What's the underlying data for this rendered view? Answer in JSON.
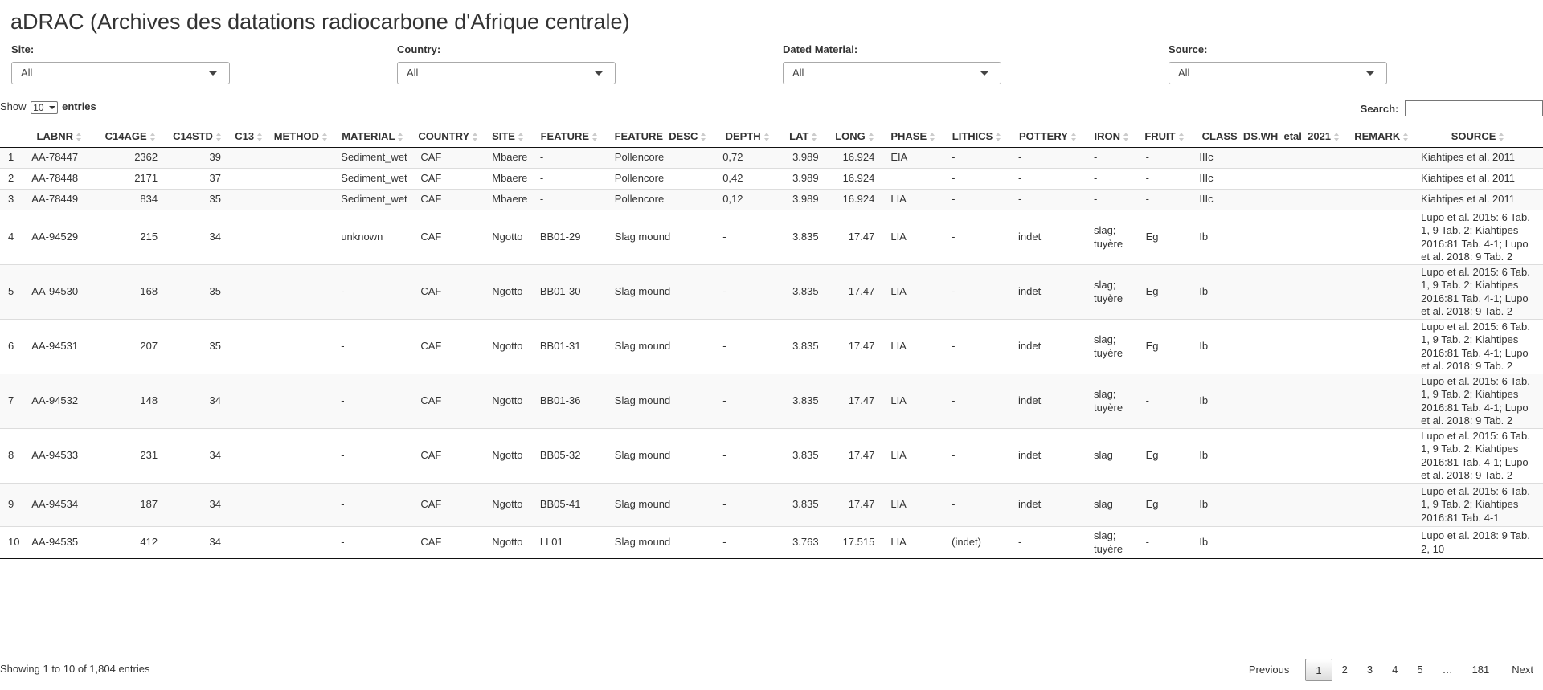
{
  "title": "aDRAC (Archives des datations radiocarbone d'Afrique centrale)",
  "filters": [
    {
      "label": "Site:",
      "value": "All"
    },
    {
      "label": "Country:",
      "value": "All"
    },
    {
      "label": "Dated Material:",
      "value": "All"
    },
    {
      "label": "Source:",
      "value": "All"
    }
  ],
  "length_control": {
    "prefix": "Show",
    "value": "10",
    "suffix": "entries"
  },
  "search": {
    "label": "Search:",
    "value": ""
  },
  "table": {
    "columns": [
      "",
      "LABNR",
      "C14AGE",
      "C14STD",
      "C13",
      "METHOD",
      "MATERIAL",
      "COUNTRY",
      "SITE",
      "FEATURE",
      "FEATURE_DESC",
      "DEPTH",
      "LAT",
      "LONG",
      "PHASE",
      "LITHICS",
      "POTTERY",
      "IRON",
      "FRUIT",
      "CLASS_DS.WH_etal_2021",
      "REMARK",
      "SOURCE"
    ],
    "rows": [
      [
        "1",
        "AA-78447",
        "2362",
        "39",
        "",
        "",
        "Sediment_wet",
        "CAF",
        "Mbaere",
        "-",
        "Pollencore",
        "0,72",
        "3.989",
        "16.924",
        "EIA",
        "-",
        "-",
        "-",
        "-",
        "IIIc",
        "",
        "Kiahtipes et al. 2011"
      ],
      [
        "2",
        "AA-78448",
        "2171",
        "37",
        "",
        "",
        "Sediment_wet",
        "CAF",
        "Mbaere",
        "-",
        "Pollencore",
        "0,42",
        "3.989",
        "16.924",
        "",
        "-",
        "-",
        "-",
        "-",
        "IIIc",
        "",
        "Kiahtipes et al. 2011"
      ],
      [
        "3",
        "AA-78449",
        "834",
        "35",
        "",
        "",
        "Sediment_wet",
        "CAF",
        "Mbaere",
        "-",
        "Pollencore",
        "0,12",
        "3.989",
        "16.924",
        "LIA",
        "-",
        "-",
        "-",
        "-",
        "IIIc",
        "",
        "Kiahtipes et al. 2011"
      ],
      [
        "4",
        "AA-94529",
        "215",
        "34",
        "",
        "",
        "unknown",
        "CAF",
        "Ngotto",
        "BB01-29",
        "Slag mound",
        "-",
        "3.835",
        "17.47",
        "LIA",
        "-",
        "indet",
        "slag; tuyère",
        "Eg",
        "Ib",
        "",
        "Lupo et al. 2015: 6 Tab. 1, 9 Tab. 2; Kiahtipes 2016:81 Tab. 4-1; Lupo et al. 2018: 9 Tab. 2"
      ],
      [
        "5",
        "AA-94530",
        "168",
        "35",
        "",
        "",
        "-",
        "CAF",
        "Ngotto",
        "BB01-30",
        "Slag mound",
        "-",
        "3.835",
        "17.47",
        "LIA",
        "-",
        "indet",
        "slag; tuyère",
        "Eg",
        "Ib",
        "",
        "Lupo et al. 2015: 6 Tab. 1, 9 Tab. 2; Kiahtipes 2016:81 Tab. 4-1; Lupo et al. 2018: 9 Tab. 2"
      ],
      [
        "6",
        "AA-94531",
        "207",
        "35",
        "",
        "",
        "-",
        "CAF",
        "Ngotto",
        "BB01-31",
        "Slag mound",
        "-",
        "3.835",
        "17.47",
        "LIA",
        "-",
        "indet",
        "slag; tuyère",
        "Eg",
        "Ib",
        "",
        "Lupo et al. 2015: 6 Tab. 1, 9 Tab. 2; Kiahtipes 2016:81 Tab. 4-1; Lupo et al. 2018: 9 Tab. 2"
      ],
      [
        "7",
        "AA-94532",
        "148",
        "34",
        "",
        "",
        "-",
        "CAF",
        "Ngotto",
        "BB01-36",
        "Slag mound",
        "-",
        "3.835",
        "17.47",
        "LIA",
        "-",
        "indet",
        "slag; tuyère",
        "-",
        "Ib",
        "",
        "Lupo et al. 2015: 6 Tab. 1, 9 Tab. 2; Kiahtipes 2016:81 Tab. 4-1; Lupo et al. 2018: 9 Tab. 2"
      ],
      [
        "8",
        "AA-94533",
        "231",
        "34",
        "",
        "",
        "-",
        "CAF",
        "Ngotto",
        "BB05-32",
        "Slag mound",
        "-",
        "3.835",
        "17.47",
        "LIA",
        "-",
        "indet",
        "slag",
        "Eg",
        "Ib",
        "",
        "Lupo et al. 2015: 6 Tab. 1, 9 Tab. 2; Kiahtipes 2016:81 Tab. 4-1; Lupo et al. 2018: 9 Tab. 2"
      ],
      [
        "9",
        "AA-94534",
        "187",
        "34",
        "",
        "",
        "-",
        "CAF",
        "Ngotto",
        "BB05-41",
        "Slag mound",
        "-",
        "3.835",
        "17.47",
        "LIA",
        "-",
        "indet",
        "slag",
        "Eg",
        "Ib",
        "",
        "Lupo et al. 2015: 6 Tab. 1, 9 Tab. 2; Kiahtipes 2016:81 Tab. 4-1"
      ],
      [
        "10",
        "AA-94535",
        "412",
        "34",
        "",
        "",
        "-",
        "CAF",
        "Ngotto",
        "LL01",
        "Slag mound",
        "-",
        "3.763",
        "17.515",
        "LIA",
        "(indet)",
        "-",
        "slag; tuyère",
        "-",
        "Ib",
        "",
        "Lupo et al. 2018: 9 Tab. 2, 10"
      ]
    ]
  },
  "info": "Showing 1 to 10 of 1,804 entries",
  "pagination": [
    "Previous",
    "1",
    "2",
    "3",
    "4",
    "5",
    "…",
    "181",
    "Next"
  ],
  "current_page": "1"
}
